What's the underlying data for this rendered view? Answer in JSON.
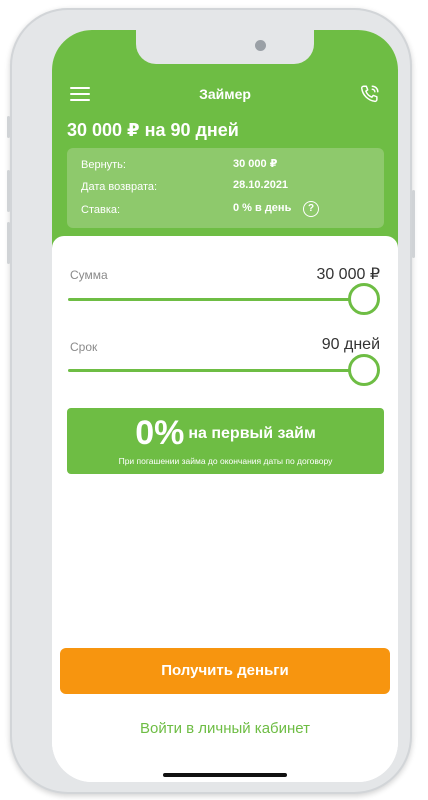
{
  "header": {
    "title": "Займер",
    "loan_summary": "30 000 ₽ на 90 дней"
  },
  "info_card": {
    "rows": [
      {
        "label": "Вернуть:",
        "value": "30 000 ₽"
      },
      {
        "label": "Дата возврата:",
        "value": "28.10.2021"
      },
      {
        "label": "Ставка:",
        "value": "0 % в день"
      }
    ],
    "help_glyph": "?"
  },
  "sliders": {
    "amount": {
      "label": "Сумма",
      "value": "30 000 ₽",
      "position_fraction": 1.0
    },
    "term": {
      "label": "Срок",
      "value": "90 дней",
      "position_fraction": 1.0
    }
  },
  "promo": {
    "big": "0%",
    "text": "на первый займ",
    "subtext": "При погашении займа до окончания даты по договору"
  },
  "actions": {
    "get_money": "Получить деньги",
    "login": "Войти в личный кабинет"
  },
  "colors": {
    "brand_green": "#6ebd44",
    "card_green": "#8ec96c",
    "cta_orange": "#f7950f"
  },
  "icons": {
    "menu": "hamburger-menu-icon",
    "phone": "phone-call-icon",
    "help": "question-circle-icon"
  }
}
